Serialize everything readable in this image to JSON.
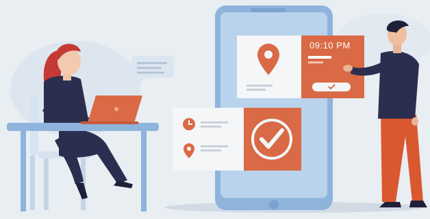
{
  "phone_card": {
    "time": "09:10 PM"
  },
  "colors": {
    "background": "#e9eef3",
    "accent_orange": "#d96a45",
    "navy": "#2c2e4f",
    "phone_blue": "#b9d3ec",
    "card_white": "#f4f6f8"
  },
  "icons": [
    "location-pin-icon",
    "clock-icon",
    "checkmark-icon",
    "laptop-icon",
    "chat-bubble-icon"
  ]
}
